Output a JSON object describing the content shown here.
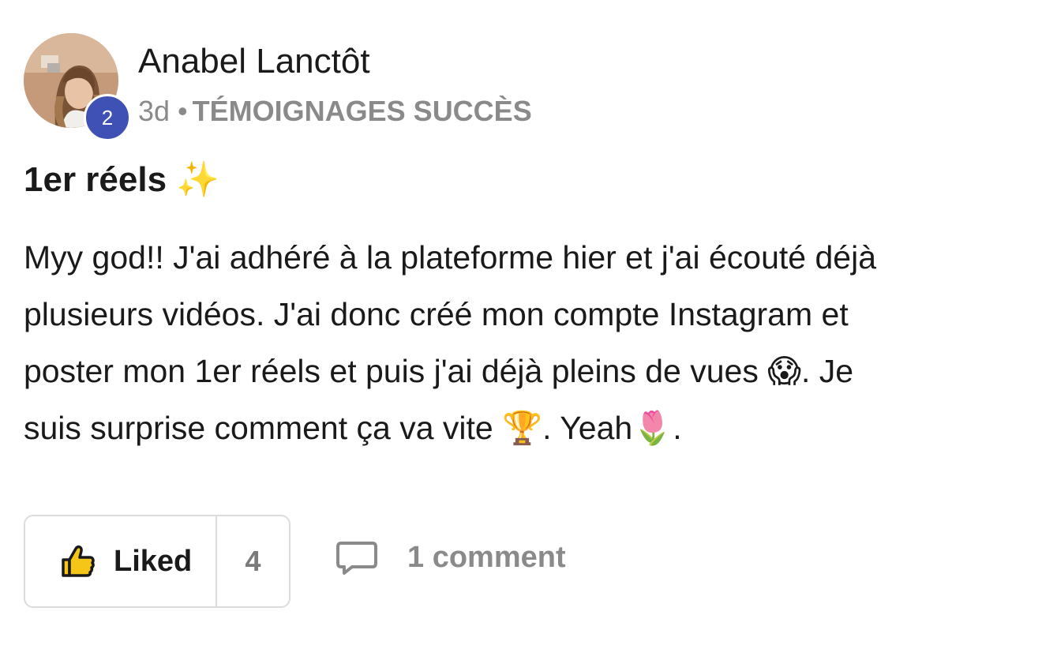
{
  "post": {
    "author": {
      "name": "Anabel Lanctôt",
      "level": "2"
    },
    "meta": {
      "time": "3d",
      "separator": "•",
      "category": "TÉMOIGNAGES SUCCÈS"
    },
    "title": "1er réels",
    "title_emoji": "✨",
    "body": {
      "line1": "Myy god!! J'ai adhéré à la plateforme hier et j'ai écouté déjà",
      "line2": "plusieurs vidéos. J'ai donc créé mon compte Instagram et",
      "line3_start": "poster mon 1er réels et puis j'ai déjà pleins de vues ",
      "line3_emoji": "😱",
      "line3_end": ". Je",
      "line4_start": "suis surprise comment ça va vite ",
      "line4_emoji": "🏆",
      "line4_mid": ". Yeah",
      "line4_emoji2": "🌷",
      "line4_end": "."
    },
    "actions": {
      "like_label": "Liked",
      "like_count": "4",
      "comment_label": "1 comment"
    },
    "colors": {
      "badge": "#3f51b5",
      "muted_text": "#8a8a8a",
      "border": "#dcdcdc"
    }
  }
}
